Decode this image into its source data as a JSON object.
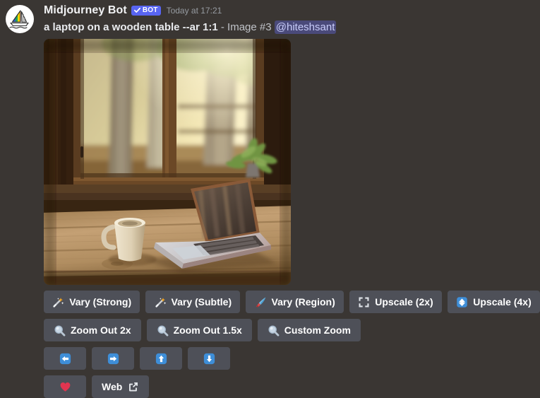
{
  "message": {
    "avatar_icon": "midjourney-sailboat-avatar",
    "author": "Midjourney Bot",
    "bot_badge": "BOT",
    "bot_badge_icon": "verified-check-icon",
    "timestamp": "Today at 17:21",
    "prompt": "a laptop on a wooden table --ar 1:1",
    "image_index": " - Image #3 ",
    "mention": "@hiteshsant"
  },
  "attachment": {
    "alt": "a laptop on a wooden table in front of a window with trees outside",
    "width": "350",
    "height": "348"
  },
  "colors": {
    "background": "#3a3633",
    "button": "#4e5058",
    "blurple": "#5865f2",
    "accent_blue": "#3e8ed8",
    "mention_bg": "#4a4a7a",
    "mention_text": "#c9cdfb",
    "heart_red": "#e03550"
  },
  "action_rows": [
    {
      "buttons": [
        {
          "label": "Vary (Strong)",
          "icon": "magic-wand-icon"
        },
        {
          "label": "Vary (Subtle)",
          "icon": "magic-wand-icon"
        },
        {
          "label": "Vary (Region)",
          "icon": "paintbrush-icon"
        },
        {
          "label": "Upscale (2x)",
          "icon": "expand-corners-icon"
        },
        {
          "label": "Upscale (4x)",
          "icon": "upscale-arrow-icon"
        }
      ]
    },
    {
      "buttons": [
        {
          "label": "Zoom Out 2x",
          "icon": "magnifying-glass-icon"
        },
        {
          "label": "Zoom Out 1.5x",
          "icon": "magnifying-glass-icon"
        },
        {
          "label": "Custom Zoom",
          "icon": "magnifying-glass-icon"
        }
      ]
    },
    {
      "buttons": [
        {
          "label": "",
          "icon": "arrow-left-icon"
        },
        {
          "label": "",
          "icon": "arrow-right-icon"
        },
        {
          "label": "",
          "icon": "arrow-up-icon"
        },
        {
          "label": "",
          "icon": "arrow-down-icon"
        }
      ]
    },
    {
      "buttons": [
        {
          "label": "",
          "icon": "heart-icon"
        },
        {
          "label": "Web",
          "icon": "external-link-icon"
        }
      ]
    }
  ]
}
